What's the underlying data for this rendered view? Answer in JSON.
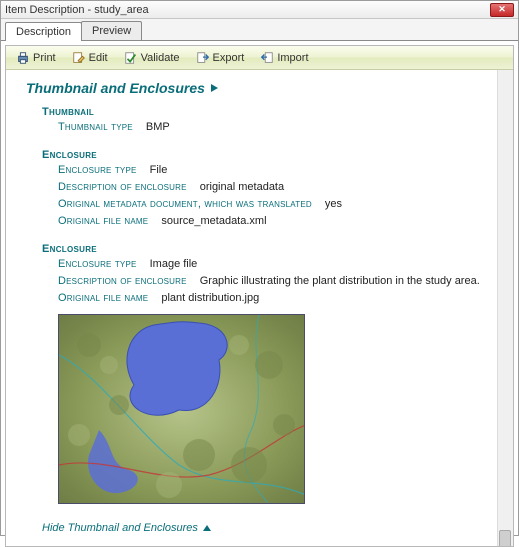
{
  "window": {
    "title": "Item Description - study_area"
  },
  "tabs": {
    "description": "Description",
    "preview": "Preview"
  },
  "toolbar": {
    "print": "Print",
    "edit": "Edit",
    "validate": "Validate",
    "export": "Export",
    "import": "Import"
  },
  "section": {
    "title": "Thumbnail and Enclosures"
  },
  "thumbnail": {
    "heading": "Thumbnail",
    "type_label": "Thumbnail type",
    "type_value": "BMP"
  },
  "enclosure1": {
    "heading": "Enclosure",
    "type_label": "Enclosure type",
    "type_value": "File",
    "desc_label": "Description of enclosure",
    "desc_value": "original metadata",
    "orig_doc_label": "Original metadata document, which was translated",
    "orig_doc_value": "yes",
    "orig_file_label": "Original file name",
    "orig_file_value": "source_metadata.xml"
  },
  "enclosure2": {
    "heading": "Enclosure",
    "type_label": "Enclosure type",
    "type_value": "Image file",
    "desc_label": "Description of enclosure",
    "desc_value": "Graphic illustrating the plant distribution in the study area.",
    "orig_file_label": "Original file name",
    "orig_file_value": "plant distribution.jpg"
  },
  "footer": {
    "hide": "Hide Thumbnail and Enclosures"
  }
}
